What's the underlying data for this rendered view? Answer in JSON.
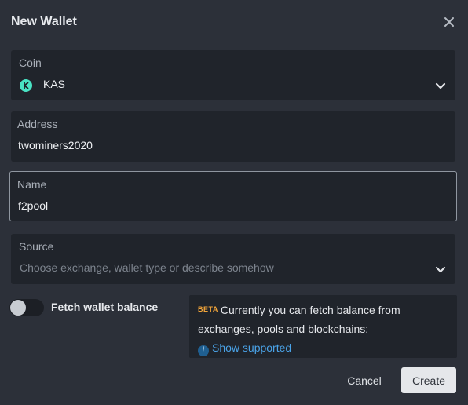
{
  "dialog": {
    "title": "New Wallet",
    "close_icon": "close-icon"
  },
  "coin": {
    "label": "Coin",
    "value": "KAS",
    "icon": "kaspa-coin-icon",
    "icon_color": "#49e3c4"
  },
  "address": {
    "label": "Address",
    "value": "twominers2020"
  },
  "name": {
    "label": "Name",
    "value": "f2pool"
  },
  "source": {
    "label": "Source",
    "placeholder": "Choose exchange, wallet type or describe somehow"
  },
  "fetch_balance": {
    "label": "Fetch wallet balance",
    "enabled": false
  },
  "info": {
    "badge": "BETA",
    "badge_color": "#f2a53a",
    "text": "Currently you can fetch balance from exchanges, pools and blockchains:",
    "link_icon": "info-icon",
    "link_text": "Show supported",
    "link_color": "#4aa3e8"
  },
  "actions": {
    "cancel_label": "Cancel",
    "create_label": "Create"
  }
}
